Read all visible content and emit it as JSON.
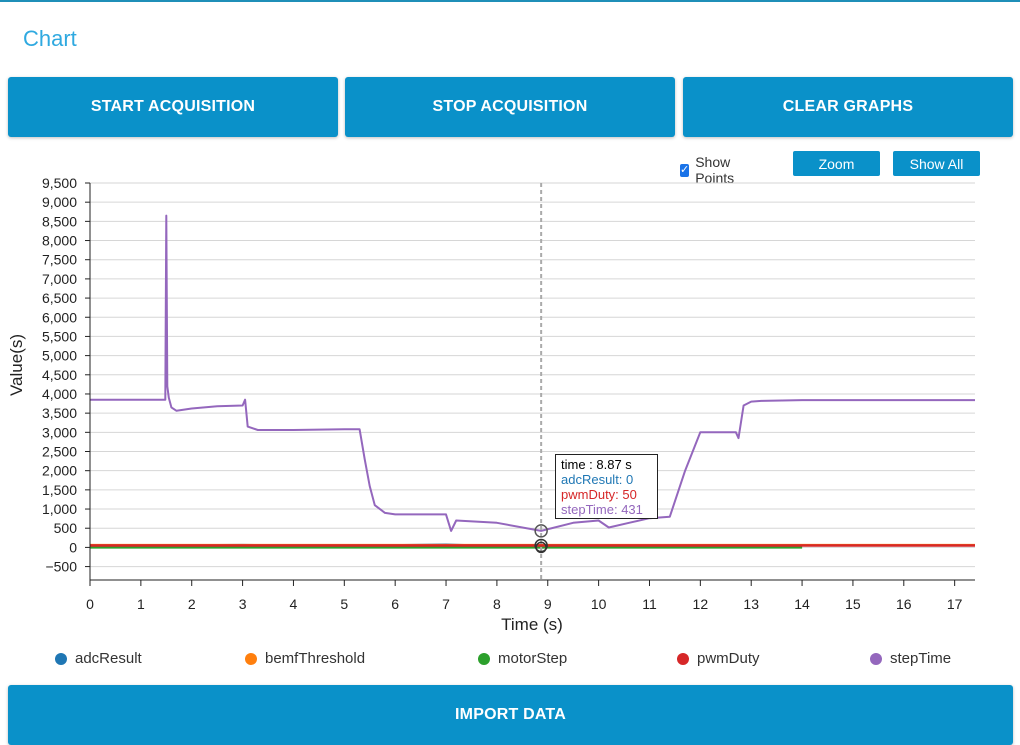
{
  "header": {
    "title": "Chart"
  },
  "toolbar": {
    "start_label": "START ACQUISITION",
    "stop_label": "STOP ACQUISITION",
    "clear_label": "CLEAR GRAPHS",
    "import_label": "IMPORT DATA"
  },
  "chart_controls": {
    "show_points_label": "Show Points",
    "show_points_checked": true,
    "zoom_label": "Zoom",
    "show_all_label": "Show All"
  },
  "tooltip": {
    "time": "time : 8.87 s",
    "adcResult": "adcResult: 0",
    "pwmDuty": "pwmDuty: 50",
    "stepTime": "stepTime: 431"
  },
  "colors": {
    "accent": "#0a91c9",
    "title": "#2fa9e0",
    "adcResult": "#1f77b4",
    "bemfThreshold": "#ff7f0e",
    "motorStep": "#2ca02c",
    "pwmDuty": "#d62728",
    "stepTime": "#9467bd"
  },
  "chart_data": {
    "type": "line",
    "xlabel": "Time (s)",
    "ylabel": "Value(s)",
    "xlim": [
      0,
      17.4
    ],
    "ylim": [
      -850,
      9500
    ],
    "x_ticks": [
      0,
      1,
      2,
      3,
      4,
      5,
      6,
      7,
      8,
      9,
      10,
      11,
      12,
      13,
      14,
      15,
      16,
      17
    ],
    "y_ticks": [
      -500,
      0,
      500,
      1000,
      1500,
      2000,
      2500,
      3000,
      3500,
      4000,
      4500,
      5000,
      5500,
      6000,
      6500,
      7000,
      7500,
      8000,
      8500,
      9000,
      9500
    ],
    "y_tick_labels": [
      "−500",
      "0",
      "500",
      "1,000",
      "1,500",
      "2,000",
      "2,500",
      "3,000",
      "3,500",
      "4,000",
      "4,500",
      "5,000",
      "5,500",
      "6,000",
      "6,500",
      "7,000",
      "7,500",
      "8,000",
      "8,500",
      "9,000",
      "9,500"
    ],
    "grid": true,
    "legend_position": "bottom",
    "crosshair_x": 8.87,
    "series": [
      {
        "name": "adcResult",
        "x": [
          0,
          1.5,
          3,
          5,
          7,
          8.87,
          10,
          12,
          14
        ],
        "y": [
          30,
          50,
          60,
          40,
          70,
          0,
          50,
          40,
          30
        ]
      },
      {
        "name": "bemfThreshold",
        "x": [
          0,
          17.4
        ],
        "y": [
          60,
          60
        ]
      },
      {
        "name": "motorStep",
        "x": [
          0,
          7,
          8.87,
          10,
          14
        ],
        "y": [
          0,
          0,
          0,
          0,
          0
        ]
      },
      {
        "name": "pwmDuty",
        "x": [
          0,
          17.4
        ],
        "y": [
          50,
          50
        ]
      },
      {
        "name": "stepTime",
        "x": [
          0,
          1.48,
          1.5,
          1.52,
          1.55,
          1.6,
          1.7,
          2.0,
          2.5,
          3.0,
          3.05,
          3.1,
          3.3,
          4.0,
          5.0,
          5.3,
          5.4,
          5.5,
          5.6,
          5.8,
          6.0,
          7.0,
          7.1,
          7.2,
          8.0,
          8.87,
          9.5,
          10.0,
          10.2,
          10.6,
          11.0,
          11.4,
          11.7,
          12.0,
          12.7,
          12.75,
          12.85,
          13.0,
          13.2,
          14.0,
          17.4
        ],
        "y": [
          3850,
          3850,
          8650,
          4200,
          3900,
          3650,
          3560,
          3620,
          3680,
          3700,
          3850,
          3150,
          3060,
          3060,
          3080,
          3080,
          2300,
          1600,
          1100,
          900,
          860,
          860,
          430,
          700,
          640,
          431,
          640,
          700,
          520,
          640,
          760,
          800,
          2000,
          3000,
          3000,
          2850,
          3700,
          3800,
          3820,
          3840,
          3840
        ]
      }
    ]
  },
  "legend": {
    "adcResult": "adcResult",
    "bemfThreshold": "bemfThreshold",
    "motorStep": "motorStep",
    "pwmDuty": "pwmDuty",
    "stepTime": "stepTime"
  }
}
